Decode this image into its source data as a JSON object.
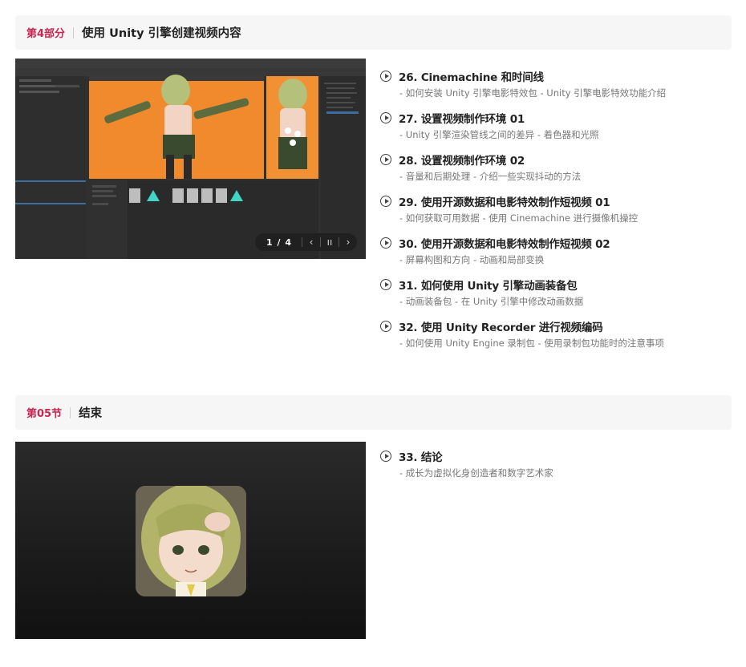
{
  "section4": {
    "number": "第4部分",
    "title": "使用 Unity 引擎创建视频内容",
    "slideshow": {
      "counter": "1 / 4",
      "prev": "‹",
      "pause": "ıı",
      "next": "›"
    },
    "lessons": [
      {
        "title": "26. Cinemachine 和时间线",
        "sub": "- 如何安装 Unity 引擎电影特效包 - Unity 引擎电影特效功能介绍"
      },
      {
        "title": "27. 设置视频制作环境 01",
        "sub": "- Unity 引擎渲染管线之间的差异 - 着色器和光照"
      },
      {
        "title": "28. 设置视频制作环境 02",
        "sub": "- 音量和后期处理 - 介绍一些实现抖动的方法"
      },
      {
        "title": "29. 使用开源数据和电影特效制作短视频 01",
        "sub": "- 如何获取可用数据 - 使用 Cinemachine 进行摄像机操控"
      },
      {
        "title": "30. 使用开源数据和电影特效制作短视频 02",
        "sub": "- 屏幕构图和方向 - 动画和局部变换"
      },
      {
        "title": "31. 如何使用 Unity 引擎动画装备包",
        "sub": "- 动画装备包 - 在 Unity 引擎中修改动画数据"
      },
      {
        "title": "32. 使用 Unity Recorder 进行视频编码",
        "sub": "- 如何使用 Unity Engine 录制包 - 使用录制包功能时的注意事项"
      }
    ]
  },
  "section5": {
    "number": "第05节",
    "title": "结束",
    "lessons": [
      {
        "title": "33. 结论",
        "sub": "- 成长为虚拟化身创造者和数字艺术家"
      }
    ]
  }
}
